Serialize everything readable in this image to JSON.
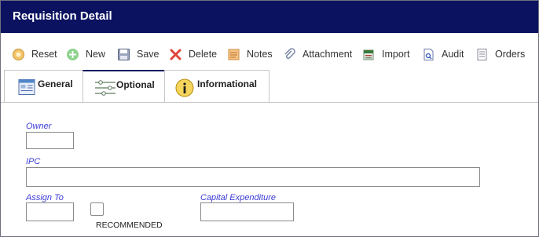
{
  "window": {
    "title": "Requisition Detail"
  },
  "toolbar": {
    "reset": "Reset",
    "new": "New",
    "save": "Save",
    "delete": "Delete",
    "notes": "Notes",
    "attachment": "Attachment",
    "import": "Import",
    "audit": "Audit",
    "orders": "Orders"
  },
  "tabs": {
    "general": "General",
    "optional": "Optional",
    "informational": "Informational",
    "active": "Optional"
  },
  "form": {
    "owner": {
      "label": "Owner",
      "value": ""
    },
    "ipc": {
      "label": "IPC",
      "value": ""
    },
    "assign_to": {
      "label": "Assign To",
      "value": ""
    },
    "recommended": {
      "label": "RECOMMENDED",
      "checked": false
    },
    "capital_expenditure": {
      "label": "Capital Expenditure",
      "value": ""
    }
  },
  "colors": {
    "titlebar": "#0b1361",
    "field_label": "#3b3bd6"
  }
}
